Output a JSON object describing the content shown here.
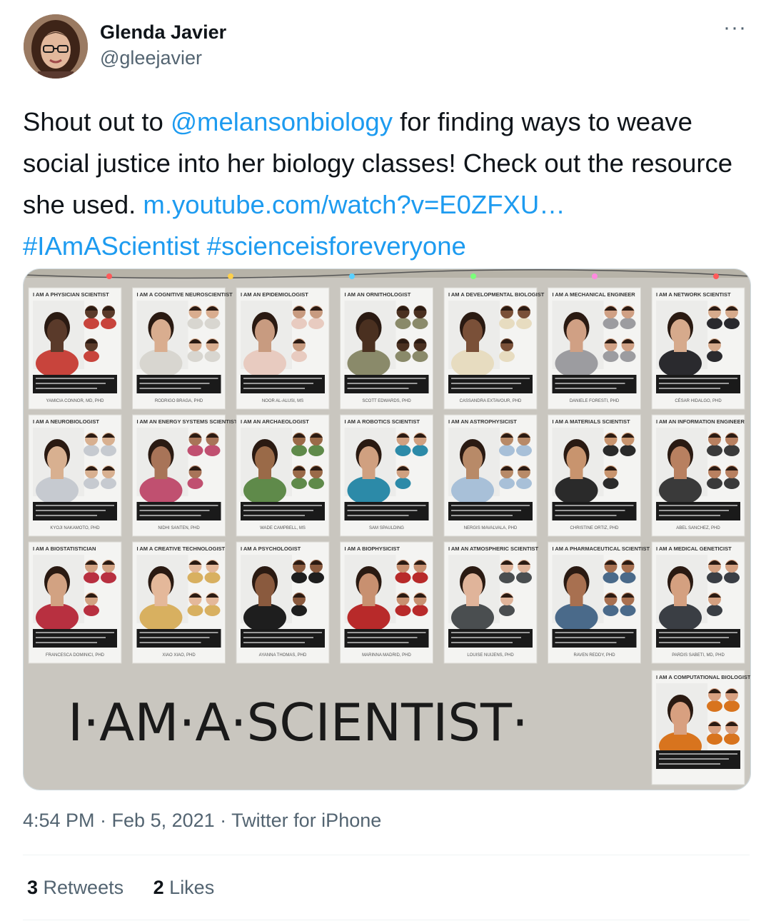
{
  "tweet": {
    "display_name": "Glenda Javier",
    "handle": "@gleejavier",
    "text_parts": {
      "p1": "Shout out to ",
      "mention": "@melansonbiology",
      "p2": " for finding ways to weave social justice into her biology classes!  Check out the resource she used.  ",
      "url": "m.youtube.com/watch?v=E0ZFXU…",
      "sp": "  ",
      "hashtag1": "#IAmAScientist",
      "sp2": " ",
      "hashtag2": "#scienceisforeveryone"
    },
    "timestamp": "4:54 PM · Feb 5, 2021 · Twitter for iPhone",
    "retweets_count": "3",
    "retweets_label": "Retweets",
    "likes_count": "2",
    "likes_label": "Likes",
    "more_glyph": "···"
  },
  "media": {
    "board_caption": "I·AM·A·SCIENTIST·",
    "posters": [
      {
        "title": "I AM A PHYSICIAN SCIENTIST",
        "name": "YAMICIA CONNOR, MD, PHD",
        "shirt": "#c8443c",
        "skin": "#5a3a2a"
      },
      {
        "title": "I AM A COGNITIVE NEUROSCIENTIST",
        "name": "RODRIGO BRAGA, PHD",
        "shirt": "#d8d6d0",
        "skin": "#d9ad8f"
      },
      {
        "title": "I AM AN EPIDEMIOLOGIST",
        "name": "NOOR AL-ALUSI, MS",
        "shirt": "#e8cbc0",
        "skin": "#c89b80"
      },
      {
        "title": "I AM AN ORNITHOLOGIST",
        "name": "SCOTT EDWARDS, PHD",
        "shirt": "#8a8a6a",
        "skin": "#4a3020"
      },
      {
        "title": "I AM A DEVELOPMENTAL BIOLOGIST",
        "name": "CASSANDRA EXTAVOUR, PHD",
        "shirt": "#e7dcc0",
        "skin": "#7a5038"
      },
      {
        "title": "I AM A MECHANICAL ENGINEER",
        "name": "DANIELE FORESTI, PHD",
        "shirt": "#9c9ca0",
        "skin": "#d0a084"
      },
      {
        "title": "I AM A NETWORK SCIENTIST",
        "name": "CÉSAR HIDALGO, PHD",
        "shirt": "#2a2a2e",
        "skin": "#d6aa8c"
      },
      {
        "title": "I AM A NEUROBIOLOGIST",
        "name": "KYOJI NAKAMOTO, PHD",
        "shirt": "#c6cad0",
        "skin": "#d8b090"
      },
      {
        "title": "I AM AN ENERGY SYSTEMS SCIENTIST",
        "name": "NIDHI SANTEN, PHD",
        "shirt": "#c05070",
        "skin": "#a87458"
      },
      {
        "title": "I AM AN ARCHAEOLOGIST",
        "name": "WADE CAMPBELL, MS",
        "shirt": "#5f8a4a",
        "skin": "#9a6a48"
      },
      {
        "title": "I AM A ROBOTICS SCIENTIST",
        "name": "SAM SPAULDING",
        "shirt": "#2c8aa8",
        "skin": "#d0a080"
      },
      {
        "title": "I AM AN ASTROPHYSICIST",
        "name": "NERGIS MAVALVALA, PHD",
        "shirt": "#a8c0d8",
        "skin": "#b88a68"
      },
      {
        "title": "I AM A MATERIALS SCIENTIST",
        "name": "CHRISTINE ORTIZ, PHD",
        "shirt": "#2a2a2a",
        "skin": "#c8946e"
      },
      {
        "title": "I AM AN INFORMATION ENGINEER",
        "name": "ABEL SANCHEZ, PHD",
        "shirt": "#3a3a3a",
        "skin": "#b88060"
      },
      {
        "title": "I AM A BIOSTATISTICIAN",
        "name": "FRANCESCA DOMINICI, PHD",
        "shirt": "#b83040",
        "skin": "#d2a282"
      },
      {
        "title": "I AM A CREATIVE TECHNOLOGIST",
        "name": "XIAO XIAO, PHD",
        "shirt": "#d8b060",
        "skin": "#e4b89a"
      },
      {
        "title": "I AM A PSYCHOLOGIST",
        "name": "AYANNA THOMAS, PHD",
        "shirt": "#1e1e1e",
        "skin": "#8a5a3e"
      },
      {
        "title": "I AM A BIOPHYSICIST",
        "name": "MARINNA MADRID, PHD",
        "shirt": "#b82a2a",
        "skin": "#c89070"
      },
      {
        "title": "I AM AN ATMOSPHERIC SCIENTIST",
        "name": "LOUISE NUIJENS, PHD",
        "shirt": "#4a4e50",
        "skin": "#e0b49a"
      },
      {
        "title": "I AM A PHARMACEUTICAL SCIENTIST",
        "name": "RAVEN REDDY, PHD",
        "shirt": "#4a6a8a",
        "skin": "#a87050"
      },
      {
        "title": "I AM A MEDICAL GENETICIST",
        "name": "PARDIS SABETI, MD, PHD",
        "shirt": "#3a3e44",
        "skin": "#d4a080"
      },
      {
        "title": "I AM A COMPUTATIONAL BIOLOGIST",
        "name": "",
        "shirt": "#d8741e",
        "skin": "#d8a080"
      }
    ]
  }
}
